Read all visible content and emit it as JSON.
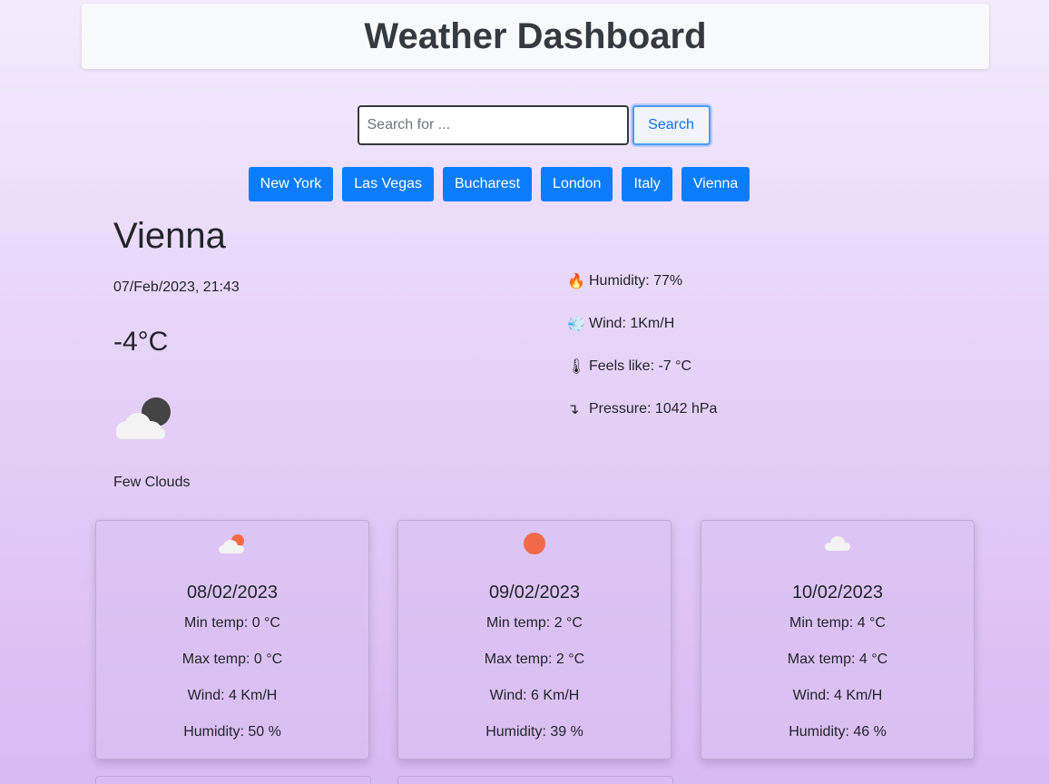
{
  "header": {
    "title": "Weather Dashboard"
  },
  "search": {
    "placeholder": "Search for ...",
    "button_label": "Search"
  },
  "cities": [
    "New York",
    "Las Vegas",
    "Bucharest",
    "London",
    "Italy",
    "Vienna"
  ],
  "current": {
    "city": "Vienna",
    "datetime": "07/Feb/2023, 21:43",
    "temperature": "-4°C",
    "icon": "few-clouds-night-icon",
    "description": "Few Clouds",
    "details": [
      {
        "icon": "fire-icon",
        "glyph": "🔥",
        "text": "Humidity: 77%"
      },
      {
        "icon": "wind-icon",
        "glyph": "💨",
        "text": "Wind: 1Km/H"
      },
      {
        "icon": "thermometer-icon",
        "glyph": "🌡",
        "text": "Feels like: -7 °C"
      },
      {
        "icon": "down-arrow-icon",
        "glyph": "↴",
        "text": "Pressure: 1042 hPa"
      }
    ]
  },
  "forecast": [
    {
      "icon": "few-clouds-day-icon",
      "date": "08/02/2023",
      "min": "Min temp: 0 °C",
      "max": "Max temp: 0 °C",
      "wind": "Wind: 4 Km/H",
      "humidity": "Humidity: 50 %"
    },
    {
      "icon": "sun-icon",
      "date": "09/02/2023",
      "min": "Min temp: 2 °C",
      "max": "Max temp: 2 °C",
      "wind": "Wind: 6 Km/H",
      "humidity": "Humidity: 39 %"
    },
    {
      "icon": "cloud-icon",
      "date": "10/02/2023",
      "min": "Min temp: 4 °C",
      "max": "Max temp: 4 °C",
      "wind": "Wind: 4 Km/H",
      "humidity": "Humidity: 46 %"
    }
  ],
  "colors": {
    "accent": "#0b7dfb",
    "sun": "#f06a4a"
  }
}
